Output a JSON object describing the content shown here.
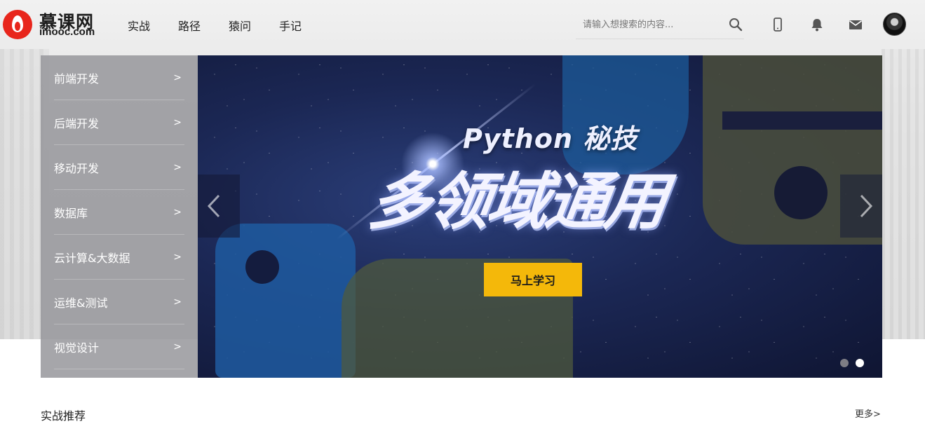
{
  "header": {
    "logo_cn": "慕课网",
    "logo_en": "imooc.com",
    "nav": [
      "实战",
      "路径",
      "猿问",
      "手记"
    ],
    "search_placeholder": "请输入想搜索的内容...",
    "icons": [
      "search-icon",
      "phone-icon",
      "bell-icon",
      "mail-icon",
      "avatar"
    ]
  },
  "categories": [
    {
      "label": "前端开发",
      "arrow": ">"
    },
    {
      "label": "后端开发",
      "arrow": ">"
    },
    {
      "label": "移动开发",
      "arrow": ">"
    },
    {
      "label": "数据库",
      "arrow": ">"
    },
    {
      "label": "云计算&大数据",
      "arrow": ">"
    },
    {
      "label": "运维&测试",
      "arrow": ">"
    },
    {
      "label": "视觉设计",
      "arrow": ">"
    }
  ],
  "banner": {
    "subtitle": "Python 秘技",
    "title": "多领域通用",
    "button": "马上学习",
    "slides_total": 2,
    "active_slide": 2
  },
  "section": {
    "title": "实战推荐",
    "more": "更多>"
  },
  "colors": {
    "brand_red": "#e8261c",
    "button_yellow": "#f4b80a",
    "menu_gray": "#96969b"
  }
}
